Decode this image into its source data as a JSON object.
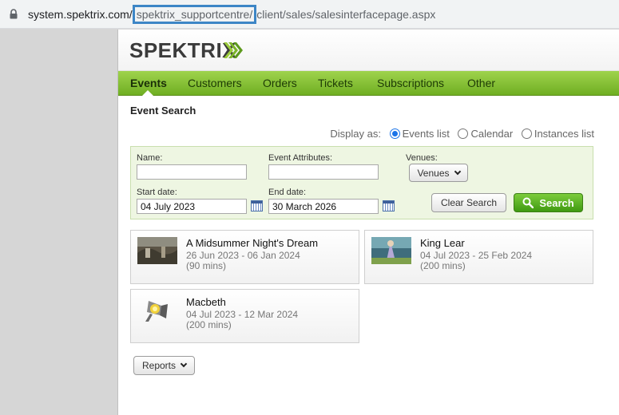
{
  "browser": {
    "url_host": "system.spektrix.com/",
    "url_highlighted": "spektrix_supportcentre/",
    "url_path": "client/sales/salesinterfacepage.aspx"
  },
  "app": {
    "logo_text": "SPEKTRIX",
    "nav": [
      {
        "label": "Events",
        "active": true
      },
      {
        "label": "Customers"
      },
      {
        "label": "Orders"
      },
      {
        "label": "Tickets"
      },
      {
        "label": "Subscriptions"
      },
      {
        "label": "Other"
      }
    ],
    "section_title": "Event Search",
    "display_as": {
      "label": "Display as:",
      "options": [
        "Events list",
        "Calendar",
        "Instances list"
      ],
      "selected": "Events list"
    },
    "search": {
      "name_label": "Name:",
      "name_value": "",
      "attributes_label": "Event Attributes:",
      "attributes_value": "",
      "venues_label": "Venues:",
      "venues_button": "Venues",
      "start_label": "Start date:",
      "start_value": "04 July 2023",
      "end_label": "End date:",
      "end_value": "30 March 2026",
      "clear_button": "Clear Search",
      "search_button": "Search"
    },
    "events": [
      {
        "title": "A Midsummer Night's Dream",
        "dates": "26 Jun 2023 -  06 Jan 2024",
        "duration": "(90 mins)"
      },
      {
        "title": "King Lear",
        "dates": "04 Jul 2023 -  25 Feb 2024",
        "duration": "(200 mins)"
      },
      {
        "title": "Macbeth",
        "dates": "04 Jul 2023 -  12 Mar 2024",
        "duration": "(200 mins)"
      }
    ],
    "reports_button": "Reports"
  },
  "colors": {
    "accent_green": "#7cc03a",
    "url_highlight": "#3d86c6",
    "radio_blue": "#1a73e8"
  }
}
